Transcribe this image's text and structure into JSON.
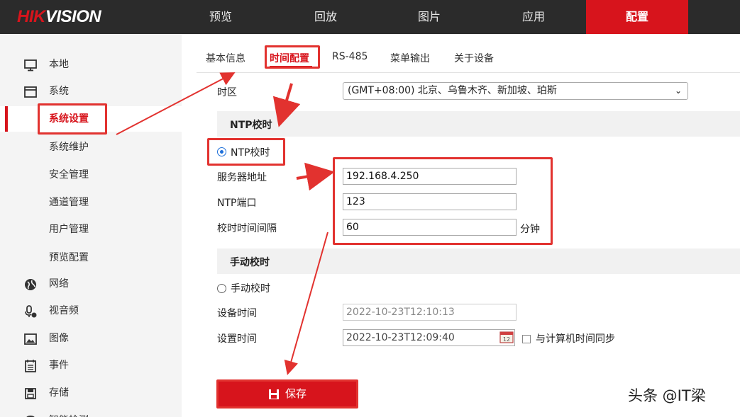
{
  "brand": {
    "logo_part1": "HIK",
    "logo_part2": "VISION"
  },
  "nav": {
    "items": [
      "预览",
      "回放",
      "图片",
      "应用",
      "配置"
    ],
    "active": "配置"
  },
  "sidebar": {
    "local": "本地",
    "system": "系统",
    "system_children": [
      "系统设置",
      "系统维护",
      "安全管理",
      "通道管理",
      "用户管理",
      "预览配置"
    ],
    "network": "网络",
    "audio_video": "视音频",
    "image": "图像",
    "event": "事件",
    "storage": "存储",
    "smart": "智能检测"
  },
  "tabs": [
    "基本信息",
    "时间配置",
    "RS-485",
    "菜单输出",
    "关于设备"
  ],
  "active_tab": "时间配置",
  "form": {
    "timezone_label": "时区",
    "timezone_value": "(GMT+08:00) 北京、乌鲁木齐、新加坡、珀斯",
    "ntp_section": "NTP校时",
    "ntp_radio_label": "NTP校时",
    "server_label": "服务器地址",
    "server_value": "192.168.4.250",
    "port_label": "NTP端口",
    "port_value": "123",
    "interval_label": "校时时间间隔",
    "interval_value": "60",
    "interval_unit": "分钟",
    "manual_section": "手动校时",
    "manual_radio_label": "手动校时",
    "device_time_label": "设备时间",
    "device_time_value": "2022-10-23T12:10:13",
    "set_time_label": "设置时间",
    "set_time_value": "2022-10-23T12:09:40",
    "sync_label": "与计算机时间同步"
  },
  "save_label": "保存",
  "watermark": "头条 @IT梁",
  "colors": {
    "brand_red": "#d7141c",
    "annotation_red": "#e2322f",
    "radio_blue": "#1e6fd9",
    "topbar": "#2b2b2b"
  }
}
